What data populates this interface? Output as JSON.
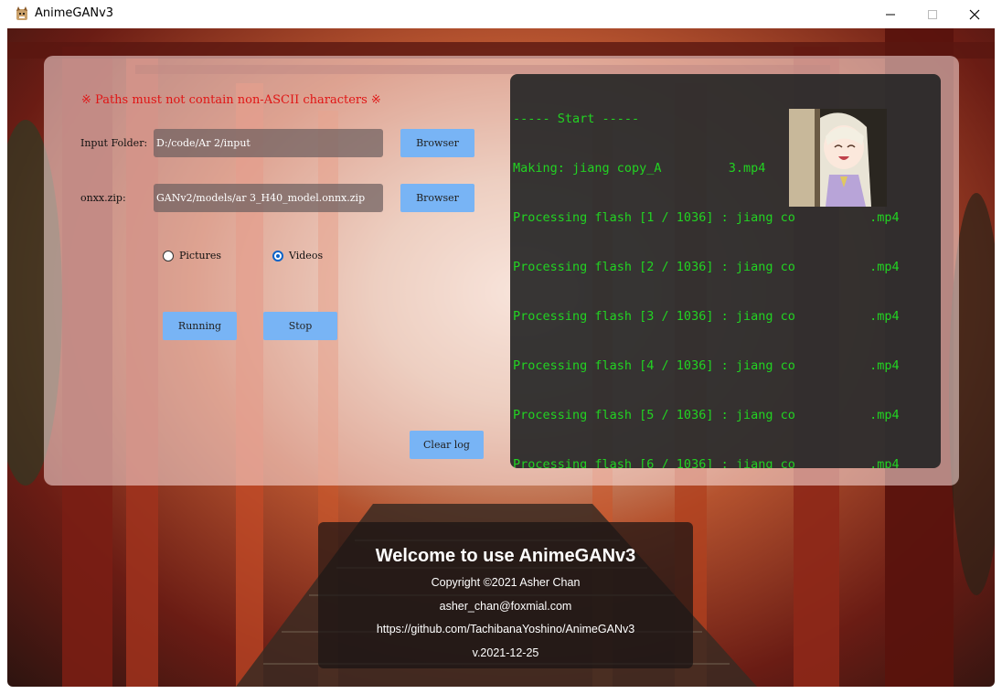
{
  "window": {
    "title": "AnimeGANv3",
    "icon": "cat-app-icon",
    "controls": [
      "minimize-icon",
      "maximize-icon",
      "close-icon"
    ]
  },
  "form": {
    "warning": "※ Paths must not contain non-ASCII characters ※",
    "input_folder_label": "Input Folder:",
    "input_folder_value": "D:/code/Ar          2/input",
    "onnx_label": "onxx.zip:",
    "onnx_value": "GANv2/models/ar          3_H40_model.onnx.zip",
    "browse1": "Browser",
    "browse2": "Browser",
    "mode_pictures": "Pictures",
    "mode_videos": "Videos",
    "selected_mode": "Videos",
    "run_label": "Running",
    "stop_label": "Stop",
    "clear_label": "Clear log"
  },
  "log": {
    "lines": [
      "----- Start -----",
      "Making: jiang copy_A         3.mp4",
      "Processing flash [1 / 1036] : jiang co          .mp4",
      "Processing flash [2 / 1036] : jiang co          .mp4",
      "Processing flash [3 / 1036] : jiang co          .mp4",
      "Processing flash [4 / 1036] : jiang co          .mp4",
      "Processing flash [5 / 1036] : jiang co          .mp4",
      "Processing flash [6 / 1036] : jiang co          .mp4"
    ],
    "text_color": "#22d322"
  },
  "welcome": {
    "title": "Welcome to use AnimeGANv3",
    "copyright": "Copyright ©2021 Asher Chan",
    "email": "asher_chan@foxmial.com",
    "url": "https://github.com/TachibanaYoshino/AnimeGANv3",
    "version": "v.2021-12-25"
  },
  "colors": {
    "button": "#78b4f5",
    "warning": "#e01515",
    "radio_selected": "#0a63c8"
  }
}
